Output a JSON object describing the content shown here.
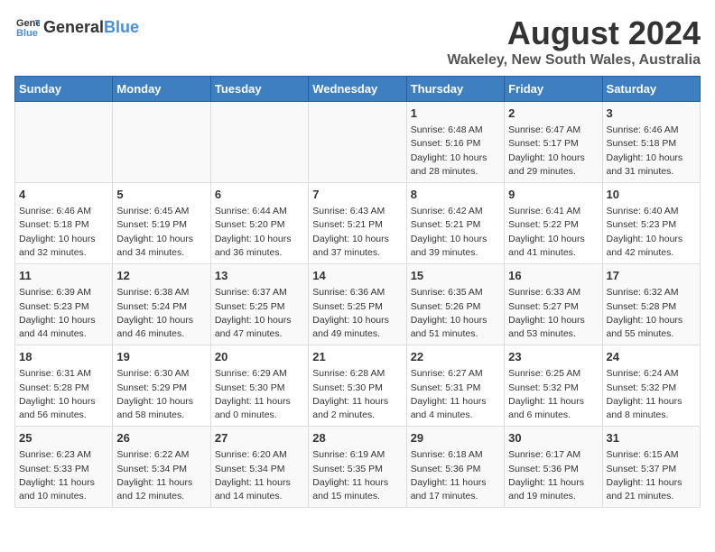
{
  "logo": {
    "general": "General",
    "blue": "Blue"
  },
  "title": "August 2024",
  "subtitle": "Wakeley, New South Wales, Australia",
  "weekdays": [
    "Sunday",
    "Monday",
    "Tuesday",
    "Wednesday",
    "Thursday",
    "Friday",
    "Saturday"
  ],
  "weeks": [
    [
      {
        "day": "",
        "info": ""
      },
      {
        "day": "",
        "info": ""
      },
      {
        "day": "",
        "info": ""
      },
      {
        "day": "",
        "info": ""
      },
      {
        "day": "1",
        "info": "Sunrise: 6:48 AM\nSunset: 5:16 PM\nDaylight: 10 hours\nand 28 minutes."
      },
      {
        "day": "2",
        "info": "Sunrise: 6:47 AM\nSunset: 5:17 PM\nDaylight: 10 hours\nand 29 minutes."
      },
      {
        "day": "3",
        "info": "Sunrise: 6:46 AM\nSunset: 5:18 PM\nDaylight: 10 hours\nand 31 minutes."
      }
    ],
    [
      {
        "day": "4",
        "info": "Sunrise: 6:46 AM\nSunset: 5:18 PM\nDaylight: 10 hours\nand 32 minutes."
      },
      {
        "day": "5",
        "info": "Sunrise: 6:45 AM\nSunset: 5:19 PM\nDaylight: 10 hours\nand 34 minutes."
      },
      {
        "day": "6",
        "info": "Sunrise: 6:44 AM\nSunset: 5:20 PM\nDaylight: 10 hours\nand 36 minutes."
      },
      {
        "day": "7",
        "info": "Sunrise: 6:43 AM\nSunset: 5:21 PM\nDaylight: 10 hours\nand 37 minutes."
      },
      {
        "day": "8",
        "info": "Sunrise: 6:42 AM\nSunset: 5:21 PM\nDaylight: 10 hours\nand 39 minutes."
      },
      {
        "day": "9",
        "info": "Sunrise: 6:41 AM\nSunset: 5:22 PM\nDaylight: 10 hours\nand 41 minutes."
      },
      {
        "day": "10",
        "info": "Sunrise: 6:40 AM\nSunset: 5:23 PM\nDaylight: 10 hours\nand 42 minutes."
      }
    ],
    [
      {
        "day": "11",
        "info": "Sunrise: 6:39 AM\nSunset: 5:23 PM\nDaylight: 10 hours\nand 44 minutes."
      },
      {
        "day": "12",
        "info": "Sunrise: 6:38 AM\nSunset: 5:24 PM\nDaylight: 10 hours\nand 46 minutes."
      },
      {
        "day": "13",
        "info": "Sunrise: 6:37 AM\nSunset: 5:25 PM\nDaylight: 10 hours\nand 47 minutes."
      },
      {
        "day": "14",
        "info": "Sunrise: 6:36 AM\nSunset: 5:25 PM\nDaylight: 10 hours\nand 49 minutes."
      },
      {
        "day": "15",
        "info": "Sunrise: 6:35 AM\nSunset: 5:26 PM\nDaylight: 10 hours\nand 51 minutes."
      },
      {
        "day": "16",
        "info": "Sunrise: 6:33 AM\nSunset: 5:27 PM\nDaylight: 10 hours\nand 53 minutes."
      },
      {
        "day": "17",
        "info": "Sunrise: 6:32 AM\nSunset: 5:28 PM\nDaylight: 10 hours\nand 55 minutes."
      }
    ],
    [
      {
        "day": "18",
        "info": "Sunrise: 6:31 AM\nSunset: 5:28 PM\nDaylight: 10 hours\nand 56 minutes."
      },
      {
        "day": "19",
        "info": "Sunrise: 6:30 AM\nSunset: 5:29 PM\nDaylight: 10 hours\nand 58 minutes."
      },
      {
        "day": "20",
        "info": "Sunrise: 6:29 AM\nSunset: 5:30 PM\nDaylight: 11 hours\nand 0 minutes."
      },
      {
        "day": "21",
        "info": "Sunrise: 6:28 AM\nSunset: 5:30 PM\nDaylight: 11 hours\nand 2 minutes."
      },
      {
        "day": "22",
        "info": "Sunrise: 6:27 AM\nSunset: 5:31 PM\nDaylight: 11 hours\nand 4 minutes."
      },
      {
        "day": "23",
        "info": "Sunrise: 6:25 AM\nSunset: 5:32 PM\nDaylight: 11 hours\nand 6 minutes."
      },
      {
        "day": "24",
        "info": "Sunrise: 6:24 AM\nSunset: 5:32 PM\nDaylight: 11 hours\nand 8 minutes."
      }
    ],
    [
      {
        "day": "25",
        "info": "Sunrise: 6:23 AM\nSunset: 5:33 PM\nDaylight: 11 hours\nand 10 minutes."
      },
      {
        "day": "26",
        "info": "Sunrise: 6:22 AM\nSunset: 5:34 PM\nDaylight: 11 hours\nand 12 minutes."
      },
      {
        "day": "27",
        "info": "Sunrise: 6:20 AM\nSunset: 5:34 PM\nDaylight: 11 hours\nand 14 minutes."
      },
      {
        "day": "28",
        "info": "Sunrise: 6:19 AM\nSunset: 5:35 PM\nDaylight: 11 hours\nand 15 minutes."
      },
      {
        "day": "29",
        "info": "Sunrise: 6:18 AM\nSunset: 5:36 PM\nDaylight: 11 hours\nand 17 minutes."
      },
      {
        "day": "30",
        "info": "Sunrise: 6:17 AM\nSunset: 5:36 PM\nDaylight: 11 hours\nand 19 minutes."
      },
      {
        "day": "31",
        "info": "Sunrise: 6:15 AM\nSunset: 5:37 PM\nDaylight: 11 hours\nand 21 minutes."
      }
    ]
  ]
}
